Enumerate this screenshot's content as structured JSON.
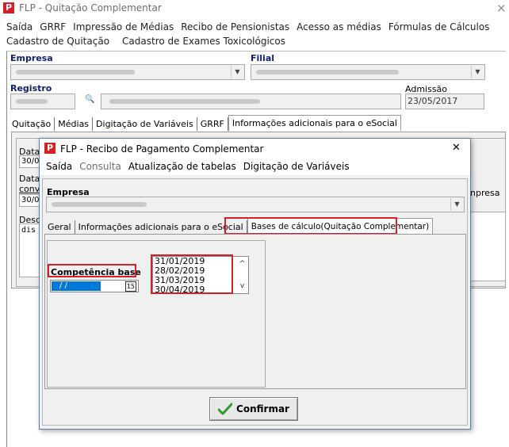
{
  "main_window": {
    "title": "FLP - Quitação Complementar",
    "logo_letter": "P",
    "close_glyph": "×",
    "menu_row1": [
      "Saída",
      "GRRF",
      "Impressão de Médias",
      "Recibo de Pensionistas",
      "Acesso as médias",
      "Fórmulas de Cálculos"
    ],
    "menu_row2": [
      "Cadastro de Quitação",
      "Cadastro de Exames Toxicológicos"
    ],
    "empresa_label": "Empresa",
    "filial_label": "Filial",
    "registro_label": "Registro",
    "admissao_label": "Admissão",
    "admissao_value": "23/05/2017",
    "search_glyph": "🔍",
    "tabs": [
      "Quitação",
      "Médias",
      "Digitação de Variáveis",
      "GRRF",
      "Informações adicionais para o eSocial"
    ],
    "panel": {
      "data_label_1": "Data",
      "data_value_1": "30/0",
      "data_label_2": "Data",
      "conv_label": "conv",
      "data_value_2": "30/0",
      "desc_label": "Desc",
      "desc_value": "dis",
      "right_text": "npresa"
    }
  },
  "dialog": {
    "title": "FLP - Recibo de Pagamento Complementar",
    "logo_letter": "P",
    "close_glyph": "✕",
    "menu": [
      {
        "label": "Saída",
        "enabled": true
      },
      {
        "label": "Consulta",
        "enabled": false
      },
      {
        "label": "Atualização de tabelas",
        "enabled": true
      },
      {
        "label": "Digitação de Variáveis",
        "enabled": true
      }
    ],
    "empresa_label": "Empresa",
    "tabs": [
      "Geral",
      "Informações adicionais para o eSocial",
      "Bases de cálculo(Quitação Complementar)"
    ],
    "competencia_label": "Competência base",
    "competencia_value": "/ /",
    "calendar_glyph": "15",
    "dates": [
      "31/01/2019",
      "28/02/2019",
      "31/03/2019",
      "30/04/2019"
    ],
    "scroll_up": "^",
    "scroll_down": "v",
    "confirm_label": "Confirmar",
    "check_icon_color": "#2e9a2e",
    "highlight_color": "#d52027",
    "selection_color": "#0078d7"
  }
}
